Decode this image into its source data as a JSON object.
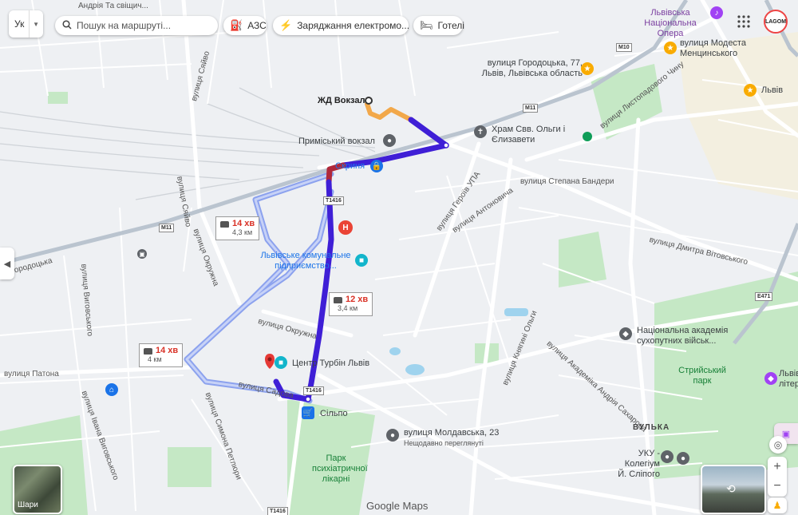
{
  "top_bar": {
    "language": "Ук",
    "search_placeholder": "Пошук на маршруті...",
    "chips": [
      "АЗС",
      "Заряджання електромо...",
      "Готелі"
    ],
    "partial_street": "Андрія Та свіщич..."
  },
  "route_boxes": [
    {
      "time": "14 хв",
      "distance": "4,3 км"
    },
    {
      "time": "12 хв",
      "distance": "3,4 км"
    },
    {
      "time": "14 хв",
      "distance": "4 км"
    }
  ],
  "places": {
    "station": "ЖД Вокзал",
    "suburban_station": "Приміський вокзал",
    "skrynia": "Скриня",
    "communal": "Львівське комунальне підприємство...",
    "turbin": "Центр Турбін Львів",
    "silpo": "Сільпо",
    "church": "Храм Свв. Ольги і Єлизавети",
    "gorodotska": "вулиця Городоцька, 77, Львів, Львівська область",
    "opera": "Львівська Національна Опера",
    "mentsynskoho": "вулиця Модеста Менцинського",
    "lviv": "Львів",
    "academy": "Національна академія сухопутних військ...",
    "park_stryi": "Стрийський парк",
    "moldavska": "вулиця Молдавська, 23",
    "moldavska_sub": "Нещодавно переглянуті",
    "psych_park": "Парк психіатричної лікарні",
    "uku": "УКУ - Колегіум Й. Сліпого",
    "vulka": "ВУЛЬКА",
    "lit": "Львівськ літер"
  },
  "streets": {
    "horodotska_w": "Городоцька",
    "siaivo1": "вулиця Сяйво",
    "siaivo2": "вулиця Сяйво",
    "okruzhna1": "вулиця Окружна",
    "okruzhna2": "вулиця Окружна",
    "vyhovskoho": "вулиця Виговського",
    "vyhovskoho2": "вулиця Івана Виговського",
    "patona": "вулиця Патона",
    "petliury": "вулиця Симона Петлюри",
    "sadova": "вулиця Садова",
    "heroiv_upa": "вулиця Героїв УПА",
    "antonovycha": "вулиця Антоновича",
    "bandery": "вулиця Степана Бандери",
    "lystopadovoho": "вулиця Листопадового Чину",
    "vitovskoho": "вулиця Дмитра Вітовського",
    "olhy": "вулиця Княгині Ольги",
    "sakharova": "вулиця Академіка Андрія Сахарова"
  },
  "shields": [
    "T1416",
    "T1416",
    "T1416",
    "M11",
    "M11",
    "M10",
    "E471"
  ],
  "footer": {
    "layers_label": "Шари",
    "google_maps": "Google Maps",
    "zoom_in": "+",
    "zoom_out": "−"
  },
  "logo_text": "LAGOM",
  "colors": {
    "route_main": "#3f1fd6",
    "route_alt": "#8ca2ee",
    "route_traffic": "#f2a84a",
    "route_red": "#b0283a",
    "park_green": "#c5e8c5",
    "water": "#9fd3ee"
  }
}
